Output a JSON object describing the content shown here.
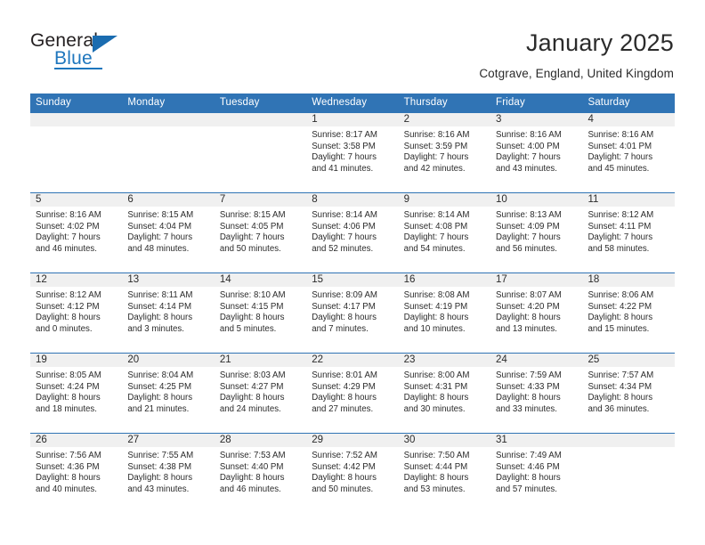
{
  "branding": {
    "name_part1": "General",
    "name_part2": "Blue",
    "logo_icon": "triangle-flag-icon"
  },
  "header": {
    "title": "January 2025",
    "location": "Cotgrave, England, United Kingdom"
  },
  "calendar": {
    "weekday_headers": [
      "Sunday",
      "Monday",
      "Tuesday",
      "Wednesday",
      "Thursday",
      "Friday",
      "Saturday"
    ],
    "accent_color": "#3074b5",
    "daynum_band_color": "#f0f0f0",
    "text_color": "#2b2b2b",
    "weeks": [
      [
        {
          "day": "",
          "empty": true,
          "sunrise": "",
          "sunset": "",
          "daylight_line1": "",
          "daylight_line2": ""
        },
        {
          "day": "",
          "empty": true,
          "sunrise": "",
          "sunset": "",
          "daylight_line1": "",
          "daylight_line2": ""
        },
        {
          "day": "",
          "empty": true,
          "sunrise": "",
          "sunset": "",
          "daylight_line1": "",
          "daylight_line2": ""
        },
        {
          "day": "1",
          "empty": false,
          "sunrise": "Sunrise: 8:17 AM",
          "sunset": "Sunset: 3:58 PM",
          "daylight_line1": "Daylight: 7 hours",
          "daylight_line2": "and 41 minutes."
        },
        {
          "day": "2",
          "empty": false,
          "sunrise": "Sunrise: 8:16 AM",
          "sunset": "Sunset: 3:59 PM",
          "daylight_line1": "Daylight: 7 hours",
          "daylight_line2": "and 42 minutes."
        },
        {
          "day": "3",
          "empty": false,
          "sunrise": "Sunrise: 8:16 AM",
          "sunset": "Sunset: 4:00 PM",
          "daylight_line1": "Daylight: 7 hours",
          "daylight_line2": "and 43 minutes."
        },
        {
          "day": "4",
          "empty": false,
          "sunrise": "Sunrise: 8:16 AM",
          "sunset": "Sunset: 4:01 PM",
          "daylight_line1": "Daylight: 7 hours",
          "daylight_line2": "and 45 minutes."
        }
      ],
      [
        {
          "day": "5",
          "empty": false,
          "sunrise": "Sunrise: 8:16 AM",
          "sunset": "Sunset: 4:02 PM",
          "daylight_line1": "Daylight: 7 hours",
          "daylight_line2": "and 46 minutes."
        },
        {
          "day": "6",
          "empty": false,
          "sunrise": "Sunrise: 8:15 AM",
          "sunset": "Sunset: 4:04 PM",
          "daylight_line1": "Daylight: 7 hours",
          "daylight_line2": "and 48 minutes."
        },
        {
          "day": "7",
          "empty": false,
          "sunrise": "Sunrise: 8:15 AM",
          "sunset": "Sunset: 4:05 PM",
          "daylight_line1": "Daylight: 7 hours",
          "daylight_line2": "and 50 minutes."
        },
        {
          "day": "8",
          "empty": false,
          "sunrise": "Sunrise: 8:14 AM",
          "sunset": "Sunset: 4:06 PM",
          "daylight_line1": "Daylight: 7 hours",
          "daylight_line2": "and 52 minutes."
        },
        {
          "day": "9",
          "empty": false,
          "sunrise": "Sunrise: 8:14 AM",
          "sunset": "Sunset: 4:08 PM",
          "daylight_line1": "Daylight: 7 hours",
          "daylight_line2": "and 54 minutes."
        },
        {
          "day": "10",
          "empty": false,
          "sunrise": "Sunrise: 8:13 AM",
          "sunset": "Sunset: 4:09 PM",
          "daylight_line1": "Daylight: 7 hours",
          "daylight_line2": "and 56 minutes."
        },
        {
          "day": "11",
          "empty": false,
          "sunrise": "Sunrise: 8:12 AM",
          "sunset": "Sunset: 4:11 PM",
          "daylight_line1": "Daylight: 7 hours",
          "daylight_line2": "and 58 minutes."
        }
      ],
      [
        {
          "day": "12",
          "empty": false,
          "sunrise": "Sunrise: 8:12 AM",
          "sunset": "Sunset: 4:12 PM",
          "daylight_line1": "Daylight: 8 hours",
          "daylight_line2": "and 0 minutes."
        },
        {
          "day": "13",
          "empty": false,
          "sunrise": "Sunrise: 8:11 AM",
          "sunset": "Sunset: 4:14 PM",
          "daylight_line1": "Daylight: 8 hours",
          "daylight_line2": "and 3 minutes."
        },
        {
          "day": "14",
          "empty": false,
          "sunrise": "Sunrise: 8:10 AM",
          "sunset": "Sunset: 4:15 PM",
          "daylight_line1": "Daylight: 8 hours",
          "daylight_line2": "and 5 minutes."
        },
        {
          "day": "15",
          "empty": false,
          "sunrise": "Sunrise: 8:09 AM",
          "sunset": "Sunset: 4:17 PM",
          "daylight_line1": "Daylight: 8 hours",
          "daylight_line2": "and 7 minutes."
        },
        {
          "day": "16",
          "empty": false,
          "sunrise": "Sunrise: 8:08 AM",
          "sunset": "Sunset: 4:19 PM",
          "daylight_line1": "Daylight: 8 hours",
          "daylight_line2": "and 10 minutes."
        },
        {
          "day": "17",
          "empty": false,
          "sunrise": "Sunrise: 8:07 AM",
          "sunset": "Sunset: 4:20 PM",
          "daylight_line1": "Daylight: 8 hours",
          "daylight_line2": "and 13 minutes."
        },
        {
          "day": "18",
          "empty": false,
          "sunrise": "Sunrise: 8:06 AM",
          "sunset": "Sunset: 4:22 PM",
          "daylight_line1": "Daylight: 8 hours",
          "daylight_line2": "and 15 minutes."
        }
      ],
      [
        {
          "day": "19",
          "empty": false,
          "sunrise": "Sunrise: 8:05 AM",
          "sunset": "Sunset: 4:24 PM",
          "daylight_line1": "Daylight: 8 hours",
          "daylight_line2": "and 18 minutes."
        },
        {
          "day": "20",
          "empty": false,
          "sunrise": "Sunrise: 8:04 AM",
          "sunset": "Sunset: 4:25 PM",
          "daylight_line1": "Daylight: 8 hours",
          "daylight_line2": "and 21 minutes."
        },
        {
          "day": "21",
          "empty": false,
          "sunrise": "Sunrise: 8:03 AM",
          "sunset": "Sunset: 4:27 PM",
          "daylight_line1": "Daylight: 8 hours",
          "daylight_line2": "and 24 minutes."
        },
        {
          "day": "22",
          "empty": false,
          "sunrise": "Sunrise: 8:01 AM",
          "sunset": "Sunset: 4:29 PM",
          "daylight_line1": "Daylight: 8 hours",
          "daylight_line2": "and 27 minutes."
        },
        {
          "day": "23",
          "empty": false,
          "sunrise": "Sunrise: 8:00 AM",
          "sunset": "Sunset: 4:31 PM",
          "daylight_line1": "Daylight: 8 hours",
          "daylight_line2": "and 30 minutes."
        },
        {
          "day": "24",
          "empty": false,
          "sunrise": "Sunrise: 7:59 AM",
          "sunset": "Sunset: 4:33 PM",
          "daylight_line1": "Daylight: 8 hours",
          "daylight_line2": "and 33 minutes."
        },
        {
          "day": "25",
          "empty": false,
          "sunrise": "Sunrise: 7:57 AM",
          "sunset": "Sunset: 4:34 PM",
          "daylight_line1": "Daylight: 8 hours",
          "daylight_line2": "and 36 minutes."
        }
      ],
      [
        {
          "day": "26",
          "empty": false,
          "sunrise": "Sunrise: 7:56 AM",
          "sunset": "Sunset: 4:36 PM",
          "daylight_line1": "Daylight: 8 hours",
          "daylight_line2": "and 40 minutes."
        },
        {
          "day": "27",
          "empty": false,
          "sunrise": "Sunrise: 7:55 AM",
          "sunset": "Sunset: 4:38 PM",
          "daylight_line1": "Daylight: 8 hours",
          "daylight_line2": "and 43 minutes."
        },
        {
          "day": "28",
          "empty": false,
          "sunrise": "Sunrise: 7:53 AM",
          "sunset": "Sunset: 4:40 PM",
          "daylight_line1": "Daylight: 8 hours",
          "daylight_line2": "and 46 minutes."
        },
        {
          "day": "29",
          "empty": false,
          "sunrise": "Sunrise: 7:52 AM",
          "sunset": "Sunset: 4:42 PM",
          "daylight_line1": "Daylight: 8 hours",
          "daylight_line2": "and 50 minutes."
        },
        {
          "day": "30",
          "empty": false,
          "sunrise": "Sunrise: 7:50 AM",
          "sunset": "Sunset: 4:44 PM",
          "daylight_line1": "Daylight: 8 hours",
          "daylight_line2": "and 53 minutes."
        },
        {
          "day": "31",
          "empty": false,
          "sunrise": "Sunrise: 7:49 AM",
          "sunset": "Sunset: 4:46 PM",
          "daylight_line1": "Daylight: 8 hours",
          "daylight_line2": "and 57 minutes."
        },
        {
          "day": "",
          "empty": true,
          "sunrise": "",
          "sunset": "",
          "daylight_line1": "",
          "daylight_line2": ""
        }
      ]
    ]
  }
}
